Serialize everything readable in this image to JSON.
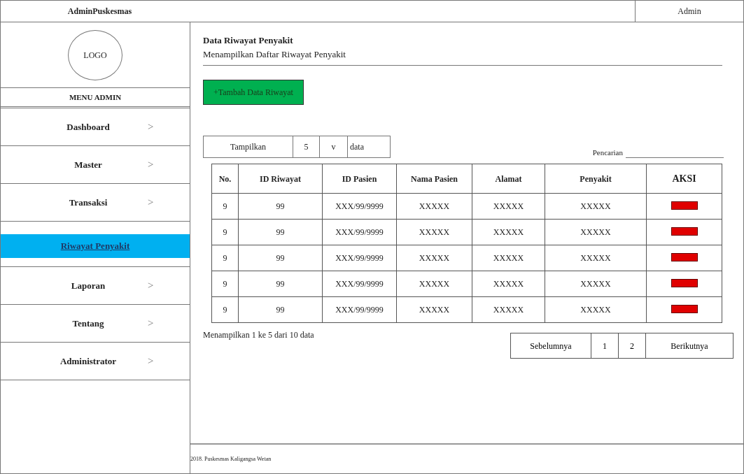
{
  "header": {
    "brand": "AdminPuskesmas",
    "user": "Admin"
  },
  "sidebar": {
    "logo": "LOGO",
    "menu_title": "MENU ADMIN",
    "items": [
      {
        "label": "Dashboard",
        "chevron": ">",
        "kind": "menu",
        "selected": false
      },
      {
        "label": "Master",
        "chevron": ">",
        "kind": "menu",
        "selected": false
      },
      {
        "label": "Transaksi",
        "chevron": ">",
        "kind": "menu",
        "selected": false
      },
      {
        "label": "Riwayat Penyakit",
        "kind": "submenu",
        "selected": true
      },
      {
        "label": "Laporan",
        "chevron": ">",
        "kind": "menu",
        "selected": false
      },
      {
        "label": "Tentang",
        "chevron": ">",
        "kind": "menu",
        "selected": false
      },
      {
        "label": "Administrator",
        "chevron": ">",
        "kind": "menu",
        "selected": false
      }
    ]
  },
  "page": {
    "title": "Data Riwayat Penyakit",
    "subtitle": "Menampilkan Daftar Riwayat Penyakit",
    "add_button": "+Tambah Data Riwayat"
  },
  "length_control": {
    "label": "Tampilkan",
    "value": "5",
    "caret": "v",
    "suffix": "data"
  },
  "search": {
    "label": "Pencarian"
  },
  "table": {
    "columns": [
      "No.",
      "ID Riwayat",
      "ID Pasien",
      "Nama Pasien",
      "Alamat",
      "Penyakit",
      "AKSI"
    ],
    "rows": [
      [
        "9",
        "99",
        "XXX/99/9999",
        "XXXXX",
        "XXXXX",
        "XXXXX"
      ],
      [
        "9",
        "99",
        "XXX/99/9999",
        "XXXXX",
        "XXXXX",
        "XXXXX"
      ],
      [
        "9",
        "99",
        "XXX/99/9999",
        "XXXXX",
        "XXXXX",
        "XXXXX"
      ],
      [
        "9",
        "99",
        "XXX/99/9999",
        "XXXXX",
        "XXXXX",
        "XXXXX"
      ],
      [
        "9",
        "99",
        "XXX/99/9999",
        "XXXXX",
        "XXXXX",
        "XXXXX"
      ]
    ]
  },
  "info": "Menampilkan 1 ke 5 dari 10 data",
  "pagination": {
    "previous": "Sebelumnya",
    "pages": [
      "1",
      "2"
    ],
    "next": "Berikutnya"
  },
  "footer": "2018. Puskesmas Kaligangsa Wetan"
}
